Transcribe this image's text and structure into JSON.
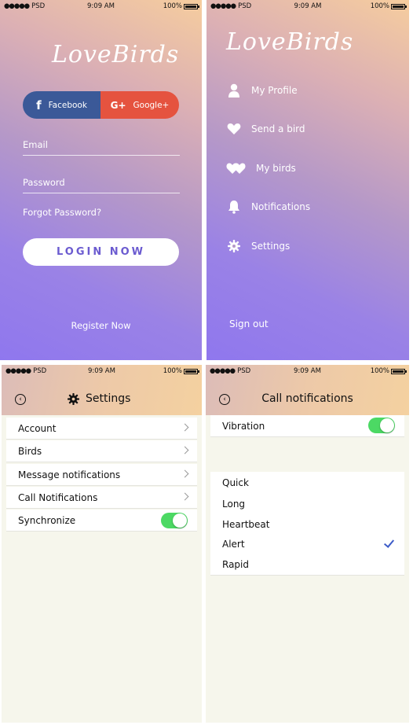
{
  "status": {
    "carrier": "PSD",
    "time": "9:09 AM",
    "battery": "100%"
  },
  "login": {
    "logo": "LoveBirds",
    "facebook_label": "Facebook",
    "google_label": "Google+",
    "email_placeholder": "Email",
    "password_placeholder": "Password",
    "forgot": "Forgot Password?",
    "login_label": "LOGIN NOW",
    "register": "Register Now"
  },
  "menu": {
    "logo": "LoveBirds",
    "items": [
      {
        "label": "My Profile",
        "icon": "user-icon"
      },
      {
        "label": "Send a bird",
        "icon": "heart-icon"
      },
      {
        "label": "My birds",
        "icon": "double-heart-icon"
      },
      {
        "label": "Notifications",
        "icon": "bell-icon"
      },
      {
        "label": "Settings",
        "icon": "gear-icon"
      }
    ],
    "signout": "Sign out"
  },
  "settings": {
    "title": "Settings",
    "rows": [
      "Account",
      "Birds",
      "Message notifications",
      "Call Notifications",
      "Synchronize"
    ],
    "synchronize_on": true
  },
  "call_notifications": {
    "title": "Call notifications",
    "vibration_label": "Vibration",
    "vibration_on": true,
    "options": [
      "Quick",
      "Long",
      "Heartbeat",
      "Alert",
      "Rapid"
    ],
    "selected": "Alert"
  },
  "colors": {
    "gradient_top": "#f6cd9e",
    "gradient_bottom": "#8f77ee",
    "facebook": "#3b5998",
    "google": "#e5533f",
    "toggle_on": "#4cd964",
    "login_text": "#6b5bd0"
  }
}
